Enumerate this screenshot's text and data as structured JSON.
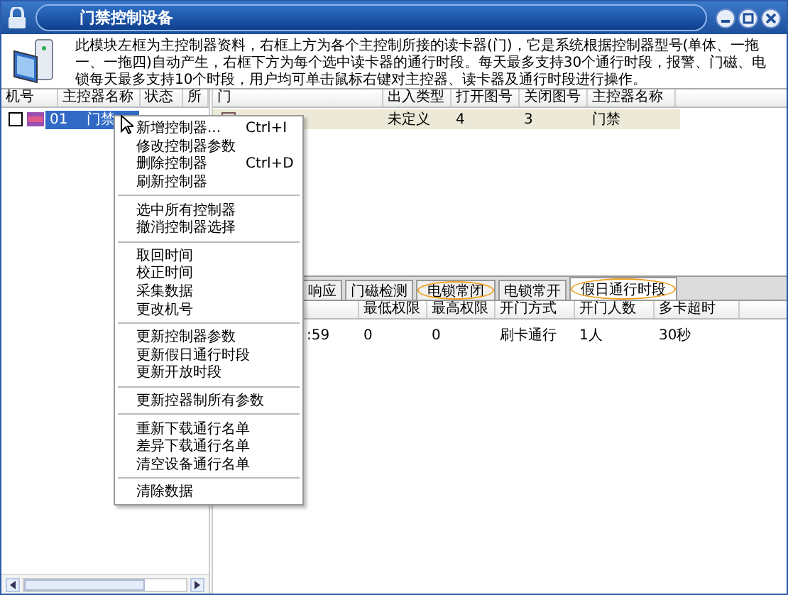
{
  "window": {
    "title": "门禁控制设备"
  },
  "description": "此模块左框为主控制器资料，右框上方为各个主控制所接的读卡器(门)，它是系统根据控制器型号(单体、一拖一、一拖四)自动产生，右框下方为每个选中读卡器的通行时段。每天最多支持30个通行时段，报警、门磁、电锁每天最多支持10个时段，用户均可单击鼠标右键对主控器、读卡器及通行时段进行操作。",
  "controllers": {
    "columns": [
      "机号",
      "主控器名称",
      "状态",
      "所"
    ],
    "rows": [
      {
        "number": "01",
        "name": "门禁",
        "checked": false,
        "selected": true
      }
    ]
  },
  "doors": {
    "columns": [
      "门",
      "出入类型",
      "打开图号",
      "关闭图号",
      "主控器名称"
    ],
    "rows": [
      {
        "type": "未定义",
        "open_no": "4",
        "close_no": "3",
        "controller": "门禁",
        "selected": true
      }
    ]
  },
  "tabs": [
    {
      "label": "响应",
      "selected": false,
      "highlighted": false
    },
    {
      "label": "门磁检测",
      "selected": false,
      "highlighted": false
    },
    {
      "label": "电锁常闭",
      "selected": false,
      "highlighted": true
    },
    {
      "label": "电锁常开",
      "selected": false,
      "highlighted": false
    },
    {
      "label": "假日通行时段",
      "selected": true,
      "highlighted": true
    }
  ],
  "periods": {
    "columns": [
      "最低权限",
      "最高权限",
      "开门方式",
      "开门人数",
      "多卡超时"
    ],
    "rows": [
      {
        "time": ":59",
        "cells": [
          "0",
          "0",
          "刷卡通行",
          "1人",
          "30秒"
        ]
      }
    ]
  },
  "context_menu": {
    "groups": [
      [
        {
          "label": "新增控制器...",
          "shortcut": "Ctrl+I"
        },
        {
          "label": "修改控制器参数"
        },
        {
          "label": "删除控制器",
          "shortcut": "Ctrl+D"
        },
        {
          "label": "刷新控制器"
        }
      ],
      [
        {
          "label": "选中所有控制器"
        },
        {
          "label": "撤消控制器选择"
        }
      ],
      [
        {
          "label": "取回时间"
        },
        {
          "label": "校正时间"
        },
        {
          "label": "采集数据"
        },
        {
          "label": "更改机号"
        }
      ],
      [
        {
          "label": "更新控制器参数"
        },
        {
          "label": "更新假日通行时段"
        },
        {
          "label": "更新开放时段"
        }
      ],
      [
        {
          "label": "更新控器制所有参数"
        }
      ],
      [
        {
          "label": "重新下载通行名单"
        },
        {
          "label": "差异下载通行名单"
        },
        {
          "label": "清空设备通行名单"
        }
      ],
      [
        {
          "label": "清除数据"
        }
      ]
    ]
  }
}
